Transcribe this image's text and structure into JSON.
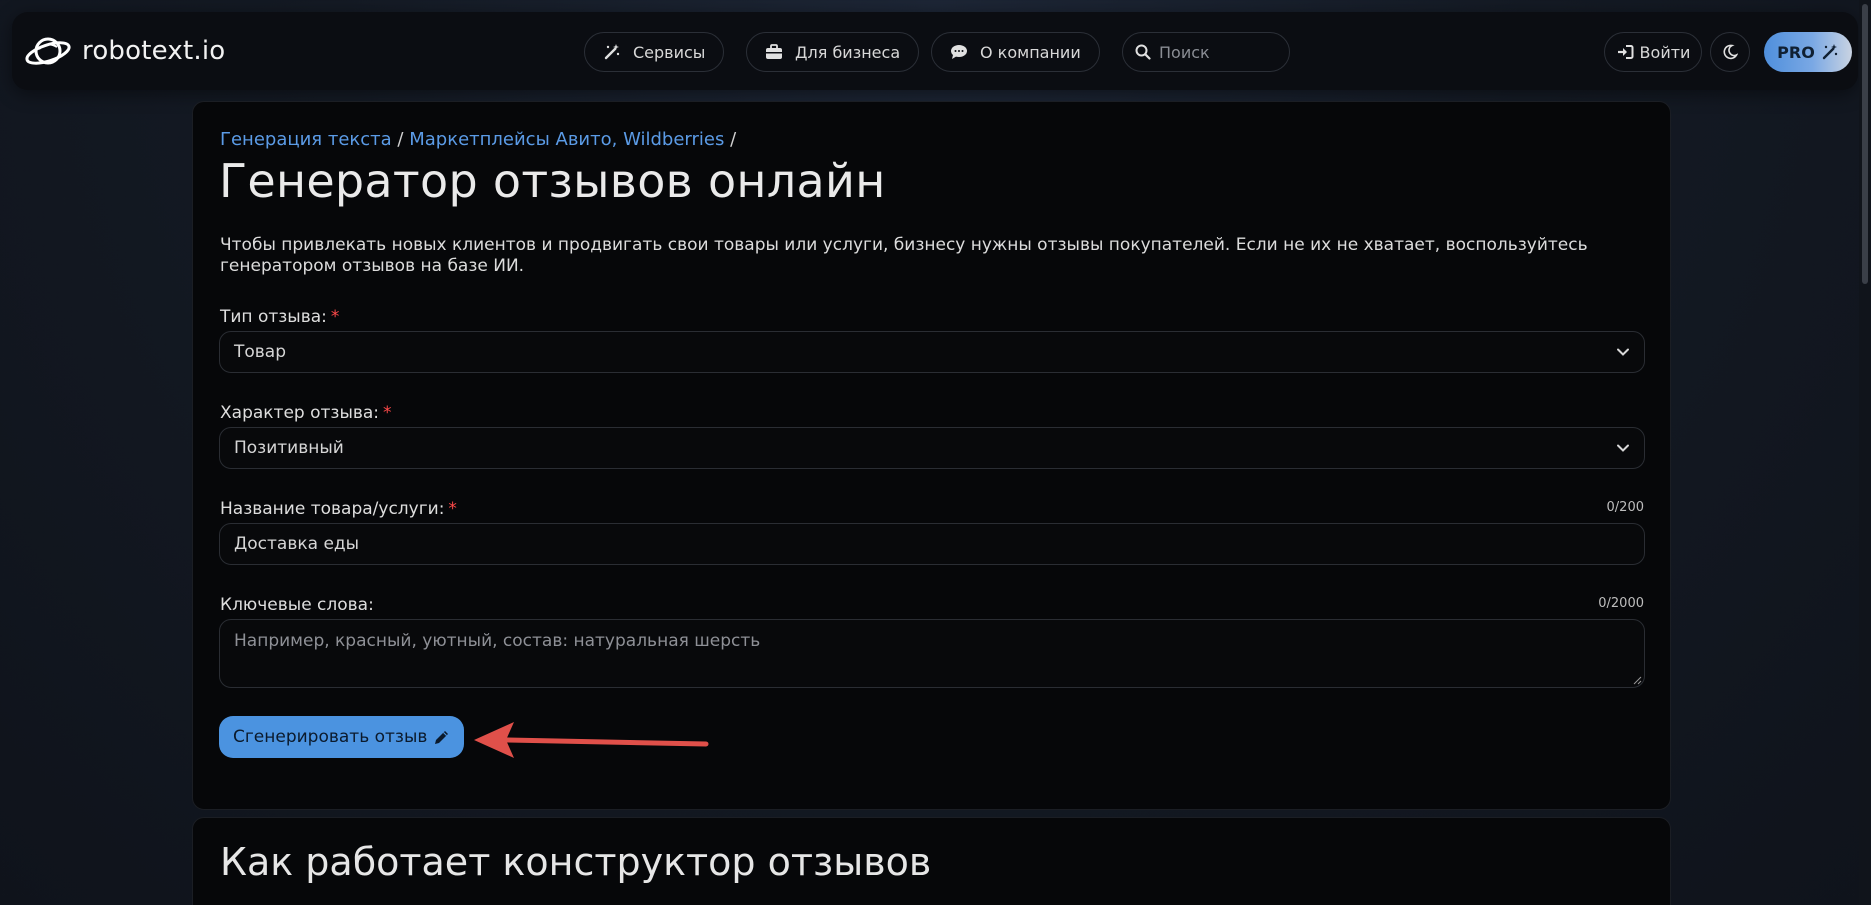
{
  "header": {
    "logo_text": "robotext.io",
    "nav": [
      {
        "label": "Сервисы",
        "icon": "magic-wand-icon"
      },
      {
        "label": "Для бизнеса",
        "icon": "briefcase-icon"
      },
      {
        "label": "О компании",
        "icon": "chat-bubble-icon"
      }
    ],
    "search_placeholder": "Поиск",
    "login_label": "Войти",
    "pro_label": "PRO"
  },
  "breadcrumb": {
    "item1": "Генерация текста",
    "sep1": " / ",
    "item2": "Маркетплейсы Авито, Wildberries",
    "sep2": " /"
  },
  "page": {
    "title": "Генератор отзывов онлайн",
    "description": "Чтобы привлекать новых клиентов и продвигать свои товары или услуги, бизнесу нужны отзывы покупателей. Если не их не хватает, воспользуйтесь генератором отзывов на базе ИИ."
  },
  "form": {
    "type": {
      "label": "Тип отзыва:",
      "required": "*",
      "value": "Товар"
    },
    "tone": {
      "label": "Характер отзыва:",
      "required": "*",
      "value": "Позитивный"
    },
    "name": {
      "label": "Название товара/услуги:",
      "required": "*",
      "value": "Доставка еды",
      "counter": "0/200"
    },
    "keywords": {
      "label": "Ключевые слова:",
      "placeholder": "Например, красный, уютный, состав: натуральная шерсть",
      "counter": "0/2000"
    },
    "submit_label": "Сгенерировать отзыв"
  },
  "section2": {
    "title": "Как работает конструктор отзывов"
  },
  "colors": {
    "accent": "#4b93e0",
    "link": "#5b9be6",
    "required": "#ff4a4a",
    "arrow": "#e0504a"
  }
}
